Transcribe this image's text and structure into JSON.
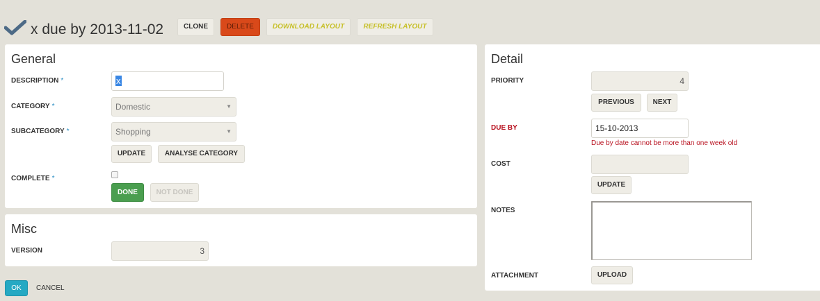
{
  "header": {
    "title": "x due by 2013-11-02",
    "icon": "checkmark-icon",
    "buttons": {
      "clone": "CLONE",
      "delete": "DELETE",
      "download_layout": "DOWNLOAD LAYOUT",
      "refresh_layout": "REFRESH LAYOUT"
    }
  },
  "general": {
    "title": "General",
    "description": {
      "label": "DESCRIPTION",
      "required": "*",
      "value": "x"
    },
    "category": {
      "label": "CATEGORY",
      "required": "*",
      "value": "Domestic"
    },
    "subcategory": {
      "label": "SUBCATEGORY",
      "required": "*",
      "value": "Shopping"
    },
    "update_button": "UPDATE",
    "analyse_button": "ANALYSE CATEGORY",
    "complete": {
      "label": "COMPLETE",
      "required": "*",
      "checked": false
    },
    "done_button": "DONE",
    "not_done_button": "NOT DONE"
  },
  "misc": {
    "title": "Misc",
    "version": {
      "label": "VERSION",
      "value": "3"
    }
  },
  "detail": {
    "title": "Detail",
    "priority": {
      "label": "PRIORITY",
      "value": "4"
    },
    "previous_button": "PREVIOUS",
    "next_button": "NEXT",
    "due_by": {
      "label": "DUE BY",
      "value": "15-10-2013",
      "error": "Due by date cannot be more than one week old"
    },
    "cost": {
      "label": "COST",
      "value": ""
    },
    "cost_update_button": "UPDATE",
    "notes": {
      "label": "NOTES",
      "value": ""
    },
    "attachment": {
      "label": "ATTACHMENT",
      "upload_button": "UPLOAD"
    }
  },
  "footer": {
    "ok_button": "OK",
    "cancel_link": "CANCEL"
  },
  "colors": {
    "background": "#e3e1d9",
    "delete": "#d9491a",
    "done": "#4a9e4f",
    "ok": "#25a9c3",
    "error": "#b8111f",
    "required": "#2d8fc4",
    "layout_buttons": "#c7c02a"
  }
}
